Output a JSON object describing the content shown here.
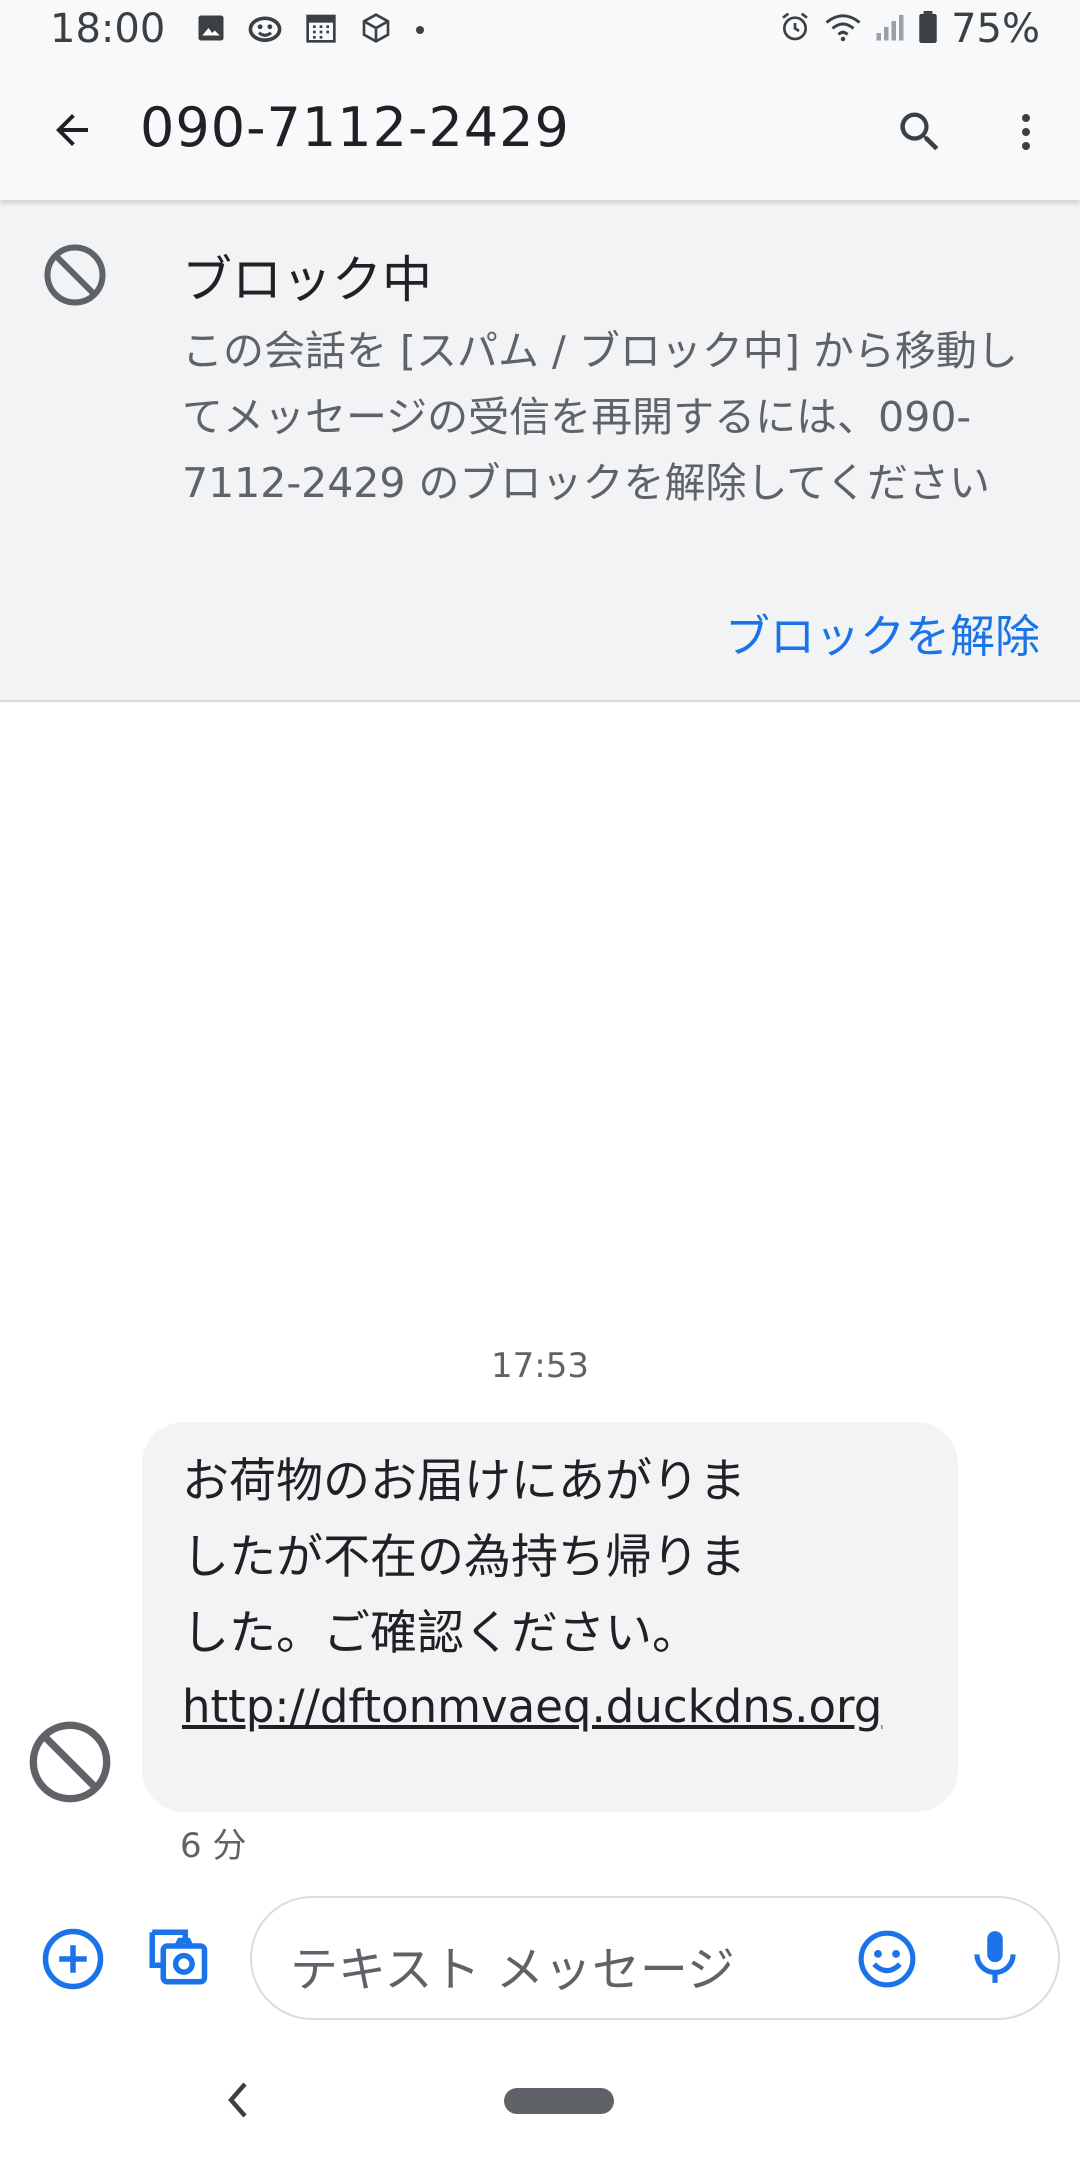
{
  "status_bar": {
    "time": "18:00",
    "battery_percent": "75%",
    "icons_left": [
      "image-icon",
      "app-notification-icon",
      "calendar-icon",
      "cube-icon",
      "dot-icon"
    ],
    "icons_right": [
      "alarm-icon",
      "wifi-icon",
      "signal-icon",
      "battery-icon"
    ]
  },
  "app_bar": {
    "title": "090-7112-2429",
    "icons": [
      "back-arrow-icon",
      "search-icon",
      "more-vert-icon"
    ]
  },
  "blocked_banner": {
    "title": "ブロック中",
    "description": "この会話を [スパム / ブロック中] から移動してメッセージの受信を再開するには、090-7112-2429 のブロックを解除してください",
    "unblock_label": "ブロックを解除"
  },
  "conversation": {
    "timestamp": "17:53",
    "message": {
      "text": "お荷物のお届けにあがりま\nしたが不在の為持ち帰りま\nした。ご確認ください。",
      "link": "http://dftonmvaeq.duckdns.org",
      "age": "6 分"
    }
  },
  "compose": {
    "placeholder": "テキスト メッセージ"
  },
  "colors": {
    "accent": "#1a73e8",
    "bar_bg": "#f8f9fa",
    "bubble_bg": "#f1f3f4",
    "secondary_text": "#5f6368"
  }
}
